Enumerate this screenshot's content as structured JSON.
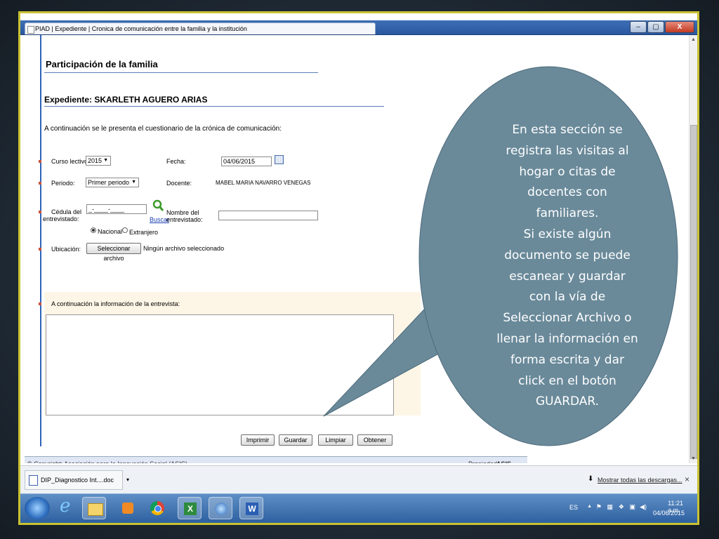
{
  "window": {
    "tab_title": "PIAD | Expediente | Cronica de comunicación entre la familia y la institución",
    "minimize": "–",
    "maximize": "▢",
    "close": "X"
  },
  "form": {
    "section_title": "Participación de la familia",
    "expediente_title": "Expediente: SKARLETH AGUERO ARIAS",
    "intro": "A continuación se le presenta el cuestionario de la crónica de comunicación:",
    "curso_label": "Curso lectivo:",
    "curso_value": "2015",
    "fecha_label": "Fecha:",
    "fecha_value": "04/06/2015",
    "periodo_label": "Periodo:",
    "periodo_value": "Primer periodo",
    "docente_label": "Docente:",
    "docente_value": "MABEL MARIA NAVARRO VENEGAS",
    "cedula_label_1": "Cédula del",
    "cedula_label_2": "entrevistado:",
    "cedula_value": "_-____-____",
    "buscar_link": "Buscar",
    "nombre_label_1": "Nombre del",
    "nombre_label_2": "entrevistado:",
    "nombre_value": "",
    "radio_nacional": "Nacional",
    "radio_extranjero": "Extranjero",
    "ubicacion_label": "Ubicación:",
    "select_file_button": "Seleccionar archivo",
    "no_file_text": "Ningún archivo seleccionado",
    "info_heading": "A continuación la información de la entrevista:",
    "buttons": {
      "imprimir": "Imprimir",
      "guardar": "Guardar",
      "limpiar": "Limpiar",
      "obtener": "Obtener"
    }
  },
  "footer": {
    "copyright": "© Copyright: Asociación para la Innovación Social (ASIS)",
    "propiedad_label": "Propiedad:",
    "propiedad_value": "ASIS"
  },
  "downloads": {
    "item": "DIP_Diagnostico Int....doc",
    "show_all": "Mostrar todas las descargas...",
    "close": "×"
  },
  "taskbar": {
    "language": "ES",
    "time": "11:21 a.m.",
    "date": "04/06/2015"
  },
  "callout": {
    "lines": [
      "En esta sección se",
      "registra las visitas al",
      "hogar o citas de",
      "docentes con",
      "familiares.",
      "Si existe algún",
      "documento se puede",
      "escanear y guardar",
      "con la vía de",
      "Seleccionar Archivo o",
      "llenar la información en",
      "forma escrita y dar",
      "click en el botón",
      "GUARDAR."
    ]
  },
  "colors": {
    "frame_border": "#c9c233",
    "callout_fill": "#6a8a9a",
    "accent_blue": "#2e63b8"
  }
}
